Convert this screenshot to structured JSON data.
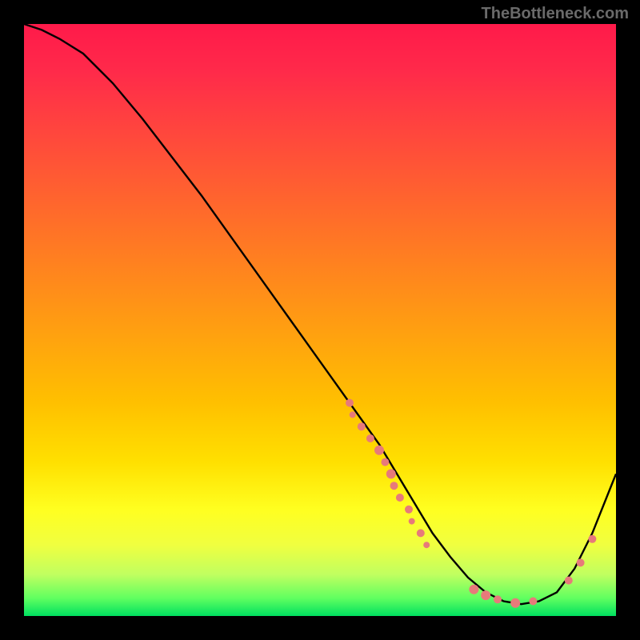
{
  "watermark": "TheBottleneck.com",
  "chart_data": {
    "type": "line",
    "title": "",
    "xlabel": "",
    "ylabel": "",
    "xlim": [
      0,
      100
    ],
    "ylim": [
      0,
      100
    ],
    "grid": false,
    "legend": false,
    "series": [
      {
        "name": "curve",
        "x": [
          0,
          3,
          6,
          10,
          15,
          20,
          25,
          30,
          35,
          40,
          45,
          50,
          55,
          60,
          63,
          66,
          69,
          72,
          75,
          78,
          81,
          84,
          87,
          90,
          93,
          96,
          100
        ],
        "y": [
          100,
          99,
          97.5,
          95,
          90,
          84,
          77.5,
          71,
          64,
          57,
          50,
          43,
          36,
          29,
          24,
          19,
          14,
          10,
          6.5,
          4,
          2.5,
          2,
          2.5,
          4,
          8,
          14,
          24
        ]
      }
    ],
    "scatter_points": [
      {
        "x": 55,
        "y": 36,
        "r": 5
      },
      {
        "x": 55.5,
        "y": 34,
        "r": 4
      },
      {
        "x": 57,
        "y": 32,
        "r": 5
      },
      {
        "x": 58.5,
        "y": 30,
        "r": 5
      },
      {
        "x": 60,
        "y": 28,
        "r": 6
      },
      {
        "x": 61,
        "y": 26,
        "r": 5
      },
      {
        "x": 62,
        "y": 24,
        "r": 6
      },
      {
        "x": 62.5,
        "y": 22,
        "r": 5
      },
      {
        "x": 63.5,
        "y": 20,
        "r": 5
      },
      {
        "x": 65,
        "y": 18,
        "r": 5
      },
      {
        "x": 65.5,
        "y": 16,
        "r": 4
      },
      {
        "x": 67,
        "y": 14,
        "r": 5
      },
      {
        "x": 68,
        "y": 12,
        "r": 4
      },
      {
        "x": 76,
        "y": 4.5,
        "r": 6
      },
      {
        "x": 78,
        "y": 3.5,
        "r": 6
      },
      {
        "x": 80,
        "y": 2.8,
        "r": 5
      },
      {
        "x": 83,
        "y": 2.2,
        "r": 6
      },
      {
        "x": 86,
        "y": 2.5,
        "r": 5
      },
      {
        "x": 92,
        "y": 6,
        "r": 5
      },
      {
        "x": 94,
        "y": 9,
        "r": 5
      },
      {
        "x": 96,
        "y": 13,
        "r": 5
      }
    ],
    "colors": {
      "curve": "#000000",
      "scatter": "#e77a7a"
    }
  }
}
